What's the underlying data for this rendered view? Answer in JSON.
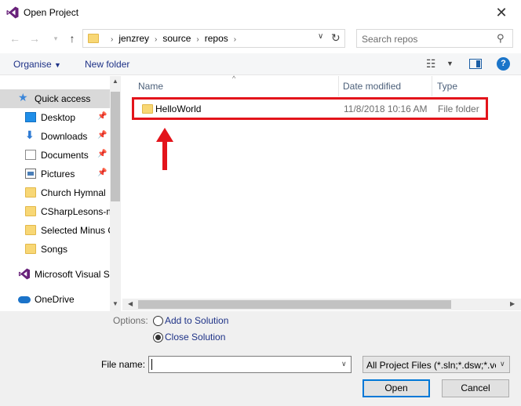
{
  "window": {
    "title": "Open Project"
  },
  "navigation": {
    "breadcrumbs": [
      "jenzrey",
      "source",
      "repos"
    ],
    "search_placeholder": "Search repos"
  },
  "toolbar": {
    "organise_label": "Organise",
    "new_folder_label": "New folder"
  },
  "sidebar": {
    "quick_access": "Quick access",
    "items": [
      {
        "label": "Desktop",
        "icon": "desktop-icon",
        "pinned": true
      },
      {
        "label": "Downloads",
        "icon": "download-icon",
        "pinned": true
      },
      {
        "label": "Documents",
        "icon": "document-icon",
        "pinned": true
      },
      {
        "label": "Pictures",
        "icon": "picture-icon",
        "pinned": true
      },
      {
        "label": "Church Hymnal",
        "icon": "folder-icon",
        "pinned": false
      },
      {
        "label": "CSharpLesons-m",
        "icon": "folder-icon",
        "pinned": false
      },
      {
        "label": "Selected Minus C",
        "icon": "folder-icon",
        "pinned": false
      },
      {
        "label": "Songs",
        "icon": "folder-icon",
        "pinned": false
      }
    ],
    "visual_studio": "Microsoft Visual S",
    "onedrive": "OneDrive"
  },
  "columns": {
    "name": "Name",
    "date_modified": "Date modified",
    "type": "Type"
  },
  "files": [
    {
      "name": "HelloWorld",
      "date_modified": "11/8/2018 10:16 AM",
      "type": "File folder"
    }
  ],
  "options": {
    "label": "Options:",
    "add_to_solution": "Add to Solution",
    "close_solution": "Close Solution",
    "selected": "close_solution"
  },
  "file_name": {
    "label": "File name:",
    "value": ""
  },
  "filter": {
    "value": "All Project Files (*.sln;*.dsw;*.vc"
  },
  "buttons": {
    "open": "Open",
    "cancel": "Cancel"
  },
  "colors": {
    "highlight": "#e3141b",
    "link": "#1e3287",
    "folder": "#f8d775"
  }
}
